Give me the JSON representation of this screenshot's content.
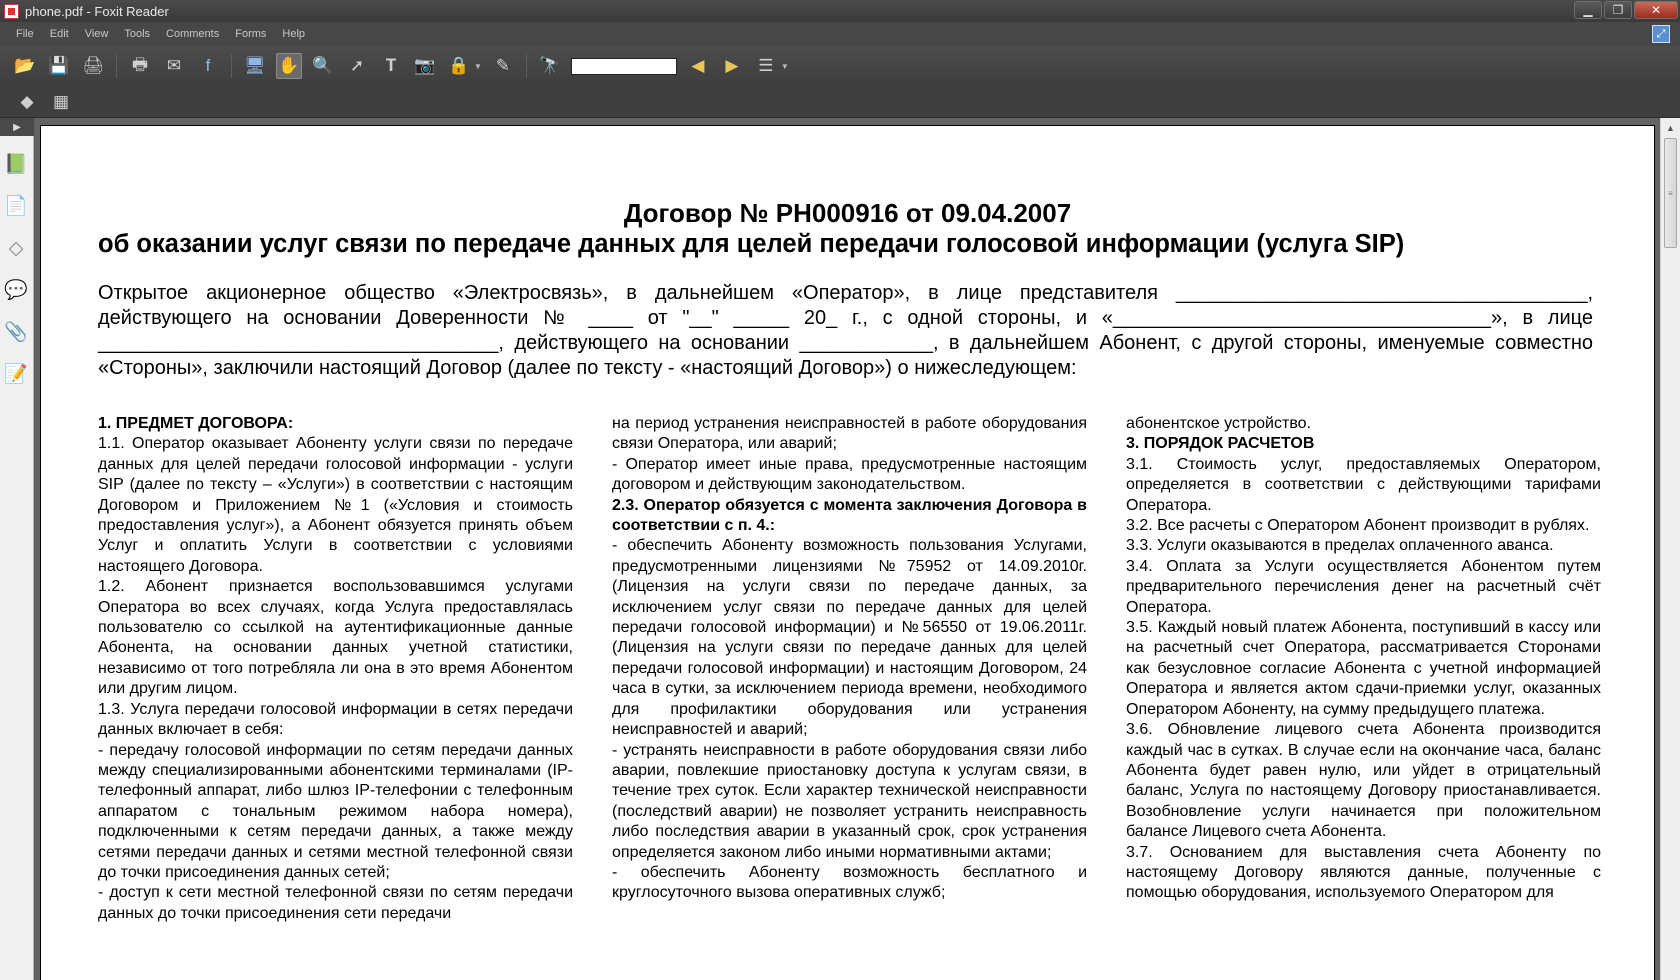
{
  "window": {
    "title": "phone.pdf - Foxit Reader"
  },
  "menu": [
    "File",
    "Edit",
    "View",
    "Tools",
    "Comments",
    "Forms",
    "Help"
  ],
  "toolbar": {
    "icons": [
      "open-icon",
      "save-icon",
      "print-icon",
      "print-icon",
      "email-icon",
      "facebook-icon",
      "snapshot-view-icon",
      "hand-tool-icon",
      "zoom-tool-icon",
      "select-tool-icon",
      "text-select-icon",
      "snapshot-icon",
      "rms-lock-icon",
      "sign-icon",
      "binoculars-icon",
      "find-prev-icon",
      "find-next-icon",
      "find-options-icon"
    ],
    "find_value": ""
  },
  "toolbar2_icons": [
    "fill-icon",
    "grid-icon"
  ],
  "left_panel_icons": [
    "bookmarks-icon",
    "pages-icon",
    "layers-icon",
    "comments-icon",
    "attachments-icon",
    "signatures-icon"
  ],
  "doc": {
    "title": "Договор № РН000916 от 09.04.2007",
    "subtitle": "об оказании услуг связи по передаче данных для целей передачи голосовой информации (услуга SIP)",
    "intro": "Открытое акционерное общество «Электросвязь», в дальнейшем «Оператор», в лице представителя _____________________________________, действующего на основании Доверенности № ____ от \"__\" _____ 20_ г., с одной стороны, и «__________________________________», в лице ____________________________________, действующего на основании ____________, в дальнейшем Абонент, с другой стороны, именуемые совместно «Стороны», заключили настоящий Договор (далее по тексту - «настоящий Договор») о нижеследующем:",
    "col1": [
      {
        "t": "1. ПРЕДМЕТ ДОГОВОРА:",
        "b": true
      },
      {
        "t": "1.1. Оператор оказывает Абоненту услуги связи по передаче данных для целей передачи голосовой информации - услуги SIP (далее по тексту – «Услуги») в соответствии с настоящим Договором и Приложением №1 («Условия и стоимость предоставления услуг»), а Абонент обязуется принять объем Услуг и оплатить Услуги в соответствии с условиями настоящего Договора."
      },
      {
        "t": "1.2. Абонент признается воспользовавшимся услугами Оператора во всех случаях, когда Услуга предоставлялась пользователю со ссылкой на аутентификационные данные Абонента, на основании данных учетной статистики, независимо от того потребляла ли она в это время Абонентом или другим лицом."
      },
      {
        "t": "1.3. Услуга передачи голосовой информации в сетях передачи данных включает в себя:"
      },
      {
        "t": "- передачу голосовой информации по сетям передачи данных между специализированными абонентскими терминалами (IP-телефонный аппарат, либо шлюз IP-телефонии с телефонным аппаратом с тональным режимом набора номера), подключенными к сетям передачи данных, а также между сетями передачи данных и сетями местной телефонной связи до точки присоединения данных сетей;"
      },
      {
        "t": "- доступ к сети местной телефонной связи по сетям передачи данных до точки присоединения сети передачи"
      }
    ],
    "col2": [
      {
        "t": "на период устранения неисправностей в работе оборудования связи Оператора, или аварий;"
      },
      {
        "t": "- Оператор имеет иные права, предусмотренные настоящим договором и действующим законодательством."
      },
      {
        "t": "2.3. Оператор обязуется с момента заключения Договора в соответствии с п. 4.:",
        "b": true
      },
      {
        "t": "- обеспечить Абоненту возможность пользования Услугами, предусмотренными лицензиями №75952 от 14.09.2010г. (Лицензия на услуги связи по передаче данных, за исключением услуг связи по передаче данных для целей передачи голосовой информации) и №56550 от 19.06.2011г. (Лицензия на услуги связи по передаче данных для целей передачи голосовой информации) и настоящим Договором, 24 часа в сутки, за исключением периода времени, необходимого для профилактики оборудования или устранения неисправностей и аварий;"
      },
      {
        "t": "- устранять неисправности в работе оборудования связи либо аварии, повлекшие приостановку доступа к услугам связи, в течение трех суток. Если характер технической неисправности (последствий аварии) не позволяет устранить неисправность либо последствия аварии в указанный срок, срок устранения определяется законом либо иными нормативными актами;"
      },
      {
        "t": "- обеспечить Абоненту возможность бесплатного и круглосуточного вызова оперативных служб;"
      }
    ],
    "col3": [
      {
        "t": "абонентское устройство."
      },
      {
        "t": "3. ПОРЯДОК РАСЧЕТОВ",
        "b": true
      },
      {
        "t": "3.1. Стоимость услуг, предоставляемых Оператором, определяется в соответствии с действующими тарифами Оператора."
      },
      {
        "t": "3.2. Все расчеты с Оператором Абонент производит в рублях."
      },
      {
        "t": "3.3. Услуги оказываются в пределах оплаченного аванса."
      },
      {
        "t": "3.4. Оплата за Услуги осуществляется Абонентом путем предварительного перечисления денег на расчетный счёт Оператора."
      },
      {
        "t": "3.5. Каждый новый платеж Абонента, поступивший в кассу или на расчетный счет Оператора, рассматривается Сторонами как безусловное согласие Абонента с учетной информацией Оператора и является актом сдачи-приемки услуг, оказанных Оператором Абоненту, на сумму предыдущего платежа."
      },
      {
        "t": "3.6. Обновление лицевого счета Абонента производится каждый час в сутках. В случае если на окончание часа, баланс Абонента будет равен нулю, или уйдет в отрицательный баланс, Услуга по настоящему Договору приостанавливается. Возобновление услуги начинается при положительном балансе Лицевого счета Абонента."
      },
      {
        "t": "3.7. Основанием для выставления счета Абоненту по настоящему Договору являются данные, полученные с помощью оборудования, используемого Оператором для"
      }
    ]
  }
}
